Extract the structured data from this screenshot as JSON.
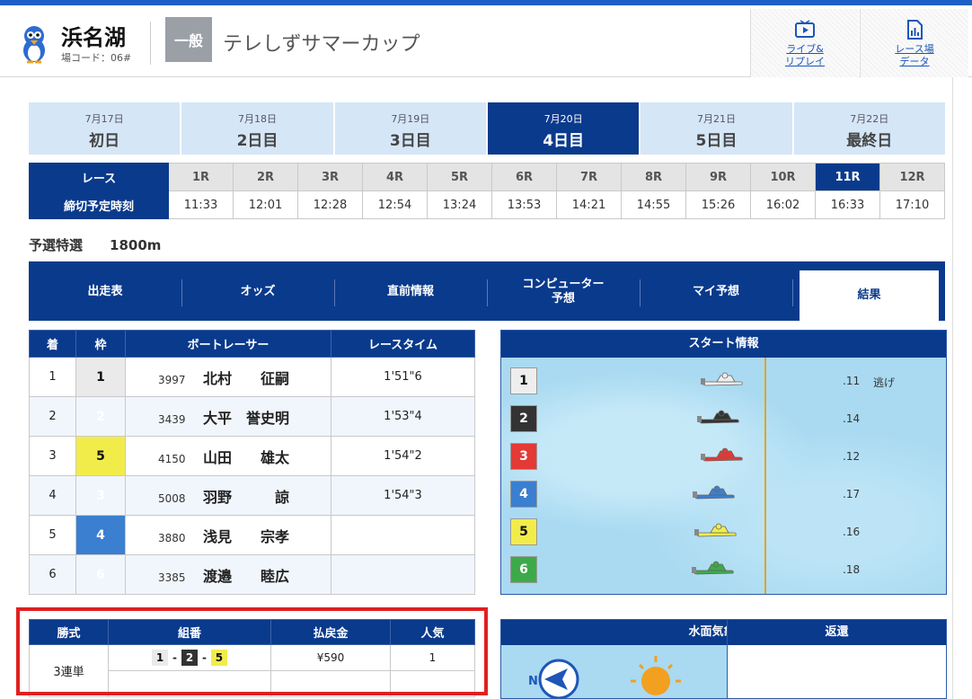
{
  "header": {
    "venue_name": "浜名湖",
    "venue_code": "場コード：06#",
    "grade": "一般",
    "race_title": "テレしずサマーカップ",
    "buttons": [
      {
        "label": "ライブ&\nリプレイ",
        "icon": "tv-play-icon"
      },
      {
        "label": "レース場\nデータ",
        "icon": "data-chart-icon"
      }
    ]
  },
  "days": [
    {
      "date": "7月17日",
      "name": "初日"
    },
    {
      "date": "7月18日",
      "name": "2日目"
    },
    {
      "date": "7月19日",
      "name": "3日目"
    },
    {
      "date": "7月20日",
      "name": "4日目",
      "active": true
    },
    {
      "date": "7月21日",
      "name": "5日目"
    },
    {
      "date": "7月22日",
      "name": "最終日"
    }
  ],
  "race_table": {
    "race_label": "レース",
    "deadline_label": "締切予定時刻",
    "races": [
      "1R",
      "2R",
      "3R",
      "4R",
      "5R",
      "6R",
      "7R",
      "8R",
      "9R",
      "10R",
      "11R",
      "12R"
    ],
    "times": [
      "11:33",
      "12:01",
      "12:28",
      "12:54",
      "13:24",
      "13:53",
      "14:21",
      "14:55",
      "15:26",
      "16:02",
      "16:33",
      "17:10"
    ],
    "active_index": 10
  },
  "race_info": {
    "type": "予選特選",
    "distance": "1800m"
  },
  "tabs": [
    "出走表",
    "オッズ",
    "直前情報",
    "コンピューター\n予想",
    "マイ予想",
    "結果"
  ],
  "active_tab": 5,
  "results": {
    "headers": [
      "着",
      "枠",
      "ボートレーサー",
      "レースタイム"
    ],
    "rows": [
      {
        "place": "1",
        "waku": "1",
        "reg": "3997",
        "name": "北村　　征嗣",
        "time": "1'51\"6"
      },
      {
        "place": "2",
        "waku": "2",
        "reg": "3439",
        "name": "大平　誉史明",
        "time": "1'53\"4"
      },
      {
        "place": "3",
        "waku": "5",
        "reg": "4150",
        "name": "山田　　雄太",
        "time": "1'54\"2"
      },
      {
        "place": "4",
        "waku": "3",
        "reg": "5008",
        "name": "羽野　　　諒",
        "time": "1'54\"3"
      },
      {
        "place": "5",
        "waku": "4",
        "reg": "3880",
        "name": "浅見　　宗孝",
        "time": ""
      },
      {
        "place": "6",
        "waku": "6",
        "reg": "3385",
        "name": "渡邉　　睦広",
        "time": ""
      }
    ]
  },
  "start_info": {
    "title": "スタート情報",
    "rows": [
      {
        "waku": "1",
        "st": ".11",
        "kimarite": "逃げ",
        "color": "#eeeeee"
      },
      {
        "waku": "2",
        "st": ".14",
        "kimarite": "",
        "color": "#333333"
      },
      {
        "waku": "3",
        "st": ".12",
        "kimarite": "",
        "color": "#e53935"
      },
      {
        "waku": "4",
        "st": ".17",
        "kimarite": "",
        "color": "#3b7fd0"
      },
      {
        "waku": "5",
        "st": ".16",
        "kimarite": "",
        "color": "#f2ec4b"
      },
      {
        "waku": "6",
        "st": ".18",
        "kimarite": "",
        "color": "#3daa4a"
      }
    ]
  },
  "payout": {
    "headers": [
      "勝式",
      "組番",
      "払戻金",
      "人気"
    ],
    "bet_type": "3連単",
    "combo": [
      "1",
      "2",
      "5"
    ],
    "amount": "¥590",
    "popularity": "1"
  },
  "weather": {
    "title": "水面気象情報"
  },
  "refund": {
    "title": "返還"
  }
}
